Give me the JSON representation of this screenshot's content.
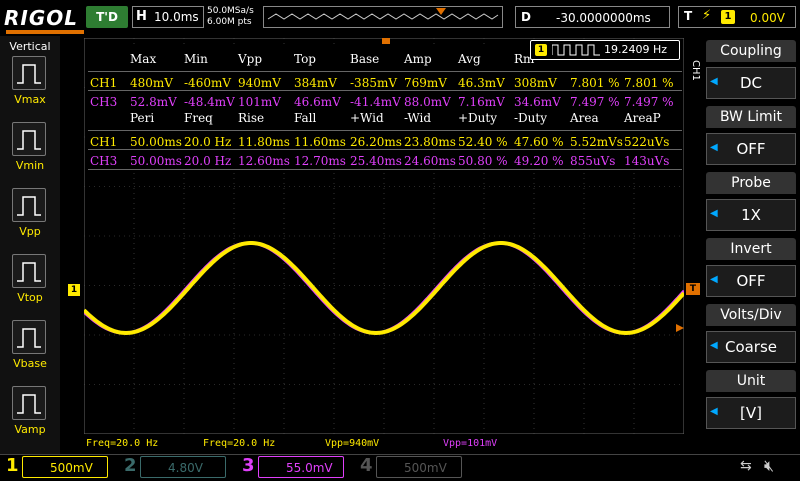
{
  "topbar": {
    "logo": "RIGOL",
    "trigger_status": "T'D",
    "h_label": "H",
    "h_scale": "10.0ms",
    "sample_rate": "50.0MSa/s",
    "memory_depth": "6.00M pts",
    "d_label": "D",
    "d_offset": "-30.0000000ms",
    "t_label": "T",
    "trigger_source": "1",
    "trigger_level": "0.00V"
  },
  "left_menu": {
    "title": "Vertical",
    "items": [
      "Vmax",
      "Vmin",
      "Vpp",
      "Vtop",
      "Vbase",
      "Vamp"
    ]
  },
  "right_menu": {
    "channel_tag": "CH1",
    "items": [
      {
        "label": "Coupling",
        "value": "DC"
      },
      {
        "label": "BW Limit",
        "value": "OFF"
      },
      {
        "label": "Probe",
        "value": "1X"
      },
      {
        "label": "Invert",
        "value": "OFF"
      },
      {
        "label": "Volts/Div",
        "value": "Coarse"
      },
      {
        "label": "Unit",
        "value": "[V]"
      }
    ]
  },
  "counter": {
    "channel": "1",
    "value": "19.2409 Hz"
  },
  "measure": {
    "header1": [
      "Max",
      "Min",
      "Vpp",
      "Top",
      "Base",
      "Amp",
      "Avg",
      "Rm"
    ],
    "ch1_row1": {
      "label": "CH1",
      "values": [
        "480mV",
        "-460mV",
        "940mV",
        "384mV",
        "-385mV",
        "769mV",
        "46.3mV",
        "308mV",
        "7.801 %",
        "7.801 %"
      ]
    },
    "ch3_row1": {
      "label": "CH3",
      "values": [
        "52.8mV",
        "-48.4mV",
        "101mV",
        "46.6mV",
        "-41.4mV",
        "88.0mV",
        "7.16mV",
        "34.6mV",
        "7.497 %",
        "7.497 %"
      ]
    },
    "header2": [
      "Peri",
      "Freq",
      "Rise",
      "Fall",
      "+Wid",
      "-Wid",
      "+Duty",
      "-Duty",
      "Area",
      "AreaP"
    ],
    "ch1_row2": {
      "label": "CH1",
      "values": [
        "50.00ms",
        "20.0 Hz",
        "11.80ms",
        "11.60ms",
        "26.20ms",
        "23.80ms",
        "52.40 %",
        "47.60 %",
        "5.52mVs",
        "522uVs"
      ]
    },
    "ch3_row2": {
      "label": "CH3",
      "values": [
        "50.00ms",
        "20.0 Hz",
        "12.60ms",
        "12.70ms",
        "25.40ms",
        "24.60ms",
        "50.80 %",
        "49.20 %",
        "855uVs",
        "143uVs"
      ]
    }
  },
  "summary": {
    "ch1_freq": "Freq=20.0 Hz",
    "ch3_freq": "Freq=20.0 Hz",
    "ch1_vpp": "Vpp=940mV",
    "ch3_vpp": "Vpp=101mV"
  },
  "channels": [
    {
      "num": "1",
      "value": "500mV",
      "color": "#ffea00"
    },
    {
      "num": "2",
      "value": "4.80V",
      "color": "#3a6a6a"
    },
    {
      "num": "3",
      "value": "55.0mV",
      "color": "#e040fb"
    },
    {
      "num": "4",
      "value": "500mV",
      "color": "#555555"
    }
  ],
  "markers": {
    "ch1_marker": "1"
  },
  "colors": {
    "ch1": "#ffea00",
    "ch3": "#e040fb",
    "accent": "#e07000",
    "trig_ok": "#2e7d32"
  }
}
